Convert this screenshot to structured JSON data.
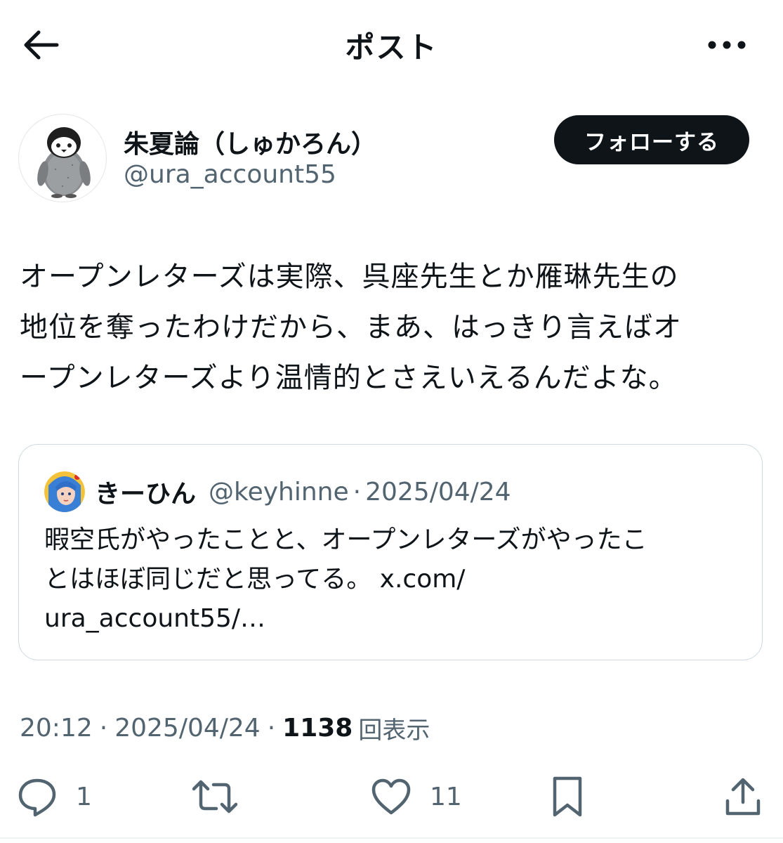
{
  "header": {
    "title": "ポスト",
    "back_icon": "arrow-left-icon",
    "more_icon": "ellipsis-icon"
  },
  "author": {
    "display_name": "朱夏論（しゅかろん）",
    "handle": "@ura_account55",
    "avatar_icon": "penguin-avatar"
  },
  "follow_button": {
    "label": "フォローする"
  },
  "post": {
    "text": "オープンレターズは実際、呉座先生とか雁琳先生の\n地位を奪ったわけだから、まあ、はっきり言えばオ\nープンレターズより温情的とさえいえるんだよな。"
  },
  "quote": {
    "display_name": "きーひん",
    "handle": "@keyhinne",
    "separator": "·",
    "date": "2025/04/24",
    "text": "暇空氏がやったことと、オープンレターズがやったこ\nとはほぼ同じだと思ってる。 ",
    "link": "x.com/\nura_account55/…"
  },
  "meta": {
    "time": "20:12",
    "separator": "·",
    "date": "2025/04/24",
    "views_count": "1138",
    "views_label": "回表示"
  },
  "actions": {
    "reply": {
      "icon": "reply-icon",
      "count": "1"
    },
    "retweet": {
      "icon": "retweet-icon",
      "count": ""
    },
    "like": {
      "icon": "heart-icon",
      "count": "11"
    },
    "bookmark": {
      "icon": "bookmark-icon",
      "count": ""
    },
    "share": {
      "icon": "share-icon",
      "count": ""
    }
  },
  "colors": {
    "text": "#0f1419",
    "secondary": "#536471",
    "border": "#cfd9de",
    "button_bg": "#0f1419"
  }
}
